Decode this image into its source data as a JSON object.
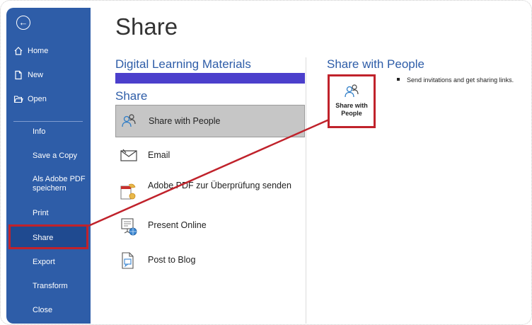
{
  "backstage": {
    "back_icon": "arrow-left-circle-icon",
    "nav_top": [
      {
        "label": "Home",
        "icon": "home-icon"
      },
      {
        "label": "New",
        "icon": "new-document-icon"
      },
      {
        "label": "Open",
        "icon": "open-folder-icon"
      }
    ],
    "nav_sub": [
      "Info",
      "Save a Copy",
      "Als Adobe PDF speichern",
      "Print",
      "Share",
      "Export",
      "Transform",
      "Close"
    ],
    "active_item": "Share"
  },
  "main": {
    "title": "Share",
    "document_name": "Digital Learning Materials",
    "share_heading": "Share",
    "options": [
      {
        "label": "Share with People",
        "icon": "people-icon",
        "selected": true
      },
      {
        "label": "Email",
        "icon": "email-icon"
      },
      {
        "label": "Adobe PDF zur Überprüfung senden",
        "icon": "adobe-pdf-review-icon"
      },
      {
        "label": "Present Online",
        "icon": "present-online-icon"
      },
      {
        "label": "Post to Blog",
        "icon": "blog-post-icon"
      }
    ]
  },
  "detail": {
    "heading": "Share with People",
    "tile_label": "Share with People",
    "tile_icon": "people-icon",
    "bullets": [
      "Send invitations and get sharing links."
    ]
  },
  "colors": {
    "sidebar": "#2e5da8",
    "accent_text": "#2e5da8",
    "highlight": "#c0222b",
    "doc_bar": "#4b3fcc"
  }
}
